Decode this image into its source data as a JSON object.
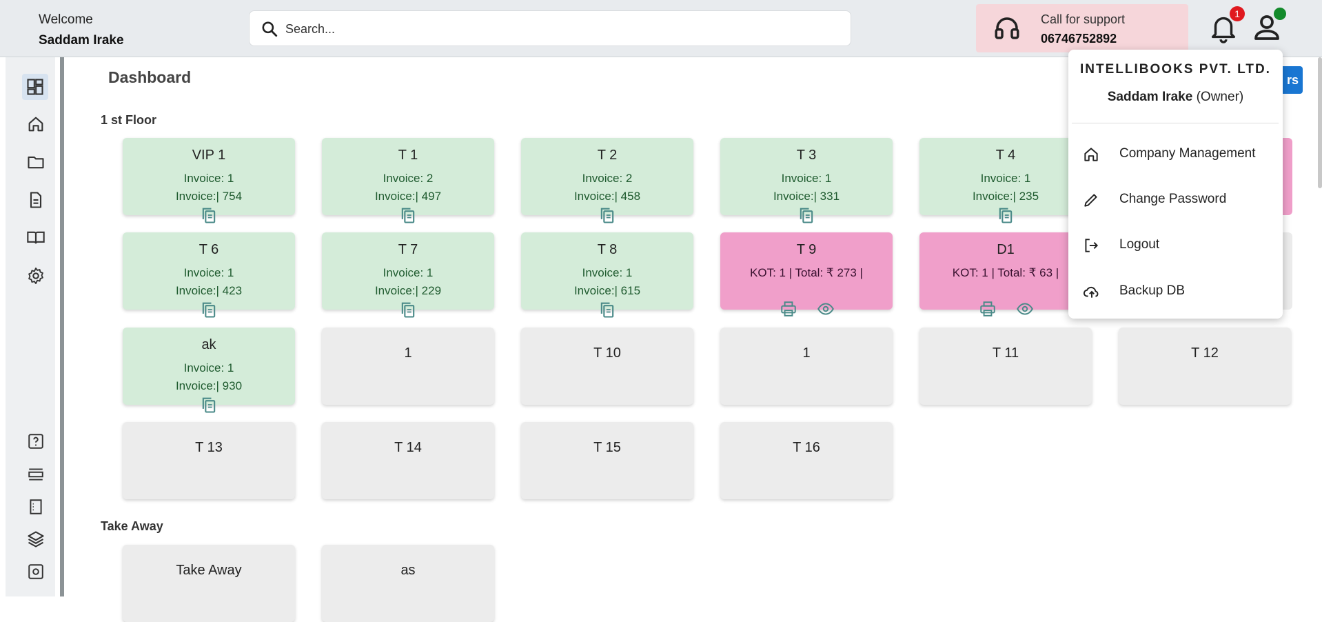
{
  "header": {
    "welcome": "Welcome",
    "user_name": "Saddam Irake",
    "search_placeholder": "Search...",
    "support_label": "Call for support",
    "support_phone": "06746752892",
    "notification_count": "1"
  },
  "main": {
    "title": "Dashboard",
    "orders_button_fragment": "rs",
    "sections": [
      {
        "title": "1 st Floor",
        "tables": [
          {
            "name": "VIP 1",
            "status": "billed",
            "line1": "Invoice: 1",
            "line2": "Invoice:| 754"
          },
          {
            "name": "T 1",
            "status": "billed",
            "line1": "Invoice: 2",
            "line2": "Invoice:| 497"
          },
          {
            "name": "T 2",
            "status": "billed",
            "line1": "Invoice: 2",
            "line2": "Invoice:| 458"
          },
          {
            "name": "T 3",
            "status": "billed",
            "line1": "Invoice: 1",
            "line2": "Invoice:| 331"
          },
          {
            "name": "T 4",
            "status": "billed",
            "line1": "Invoice: 1",
            "line2": "Invoice:| 235"
          },
          {
            "name": "T 6",
            "status": "billed",
            "line1": "Invoice: 1",
            "line2": "Invoice:| 423"
          },
          {
            "name": "T 7",
            "status": "billed",
            "line1": "Invoice: 1",
            "line2": "Invoice:| 229"
          },
          {
            "name": "T 8",
            "status": "billed",
            "line1": "Invoice: 1",
            "line2": "Invoice:| 615"
          },
          {
            "name": "T 9",
            "status": "running",
            "line1": "KOT: 1 | Total: ₹ 273 |"
          },
          {
            "name": "D1",
            "status": "running",
            "line1": "KOT: 1 | Total: ₹ 63 |"
          },
          {
            "name": "ak",
            "status": "billed",
            "line1": "Invoice: 1",
            "line2": "Invoice:| 930"
          },
          {
            "name": "1",
            "status": "free"
          },
          {
            "name": "T 10",
            "status": "free"
          },
          {
            "name": "1",
            "status": "free"
          },
          {
            "name": "T 11",
            "status": "free"
          },
          {
            "name": "T 12",
            "status": "free"
          },
          {
            "name": "T 13",
            "status": "free"
          },
          {
            "name": "T 14",
            "status": "free"
          },
          {
            "name": "T 15",
            "status": "free"
          },
          {
            "name": "T 16",
            "status": "free"
          }
        ]
      },
      {
        "title": "Take Away",
        "tables": [
          {
            "name": "Take Away",
            "status": "free"
          },
          {
            "name": "as",
            "status": "free"
          }
        ]
      }
    ]
  },
  "profile_menu": {
    "company": "INTELLIBOOKS PVT. LTD.",
    "user_name": "Saddam Irake",
    "role": "(Owner)",
    "items": [
      {
        "label": "Company Management",
        "icon": "home-icon"
      },
      {
        "label": "Change Password",
        "icon": "pencil-icon"
      },
      {
        "label": "Logout",
        "icon": "logout-icon"
      },
      {
        "label": "Backup DB",
        "icon": "cloud-upload-icon"
      }
    ]
  },
  "sidebar": {
    "items": [
      {
        "icon": "dashboard-icon"
      },
      {
        "icon": "home-icon"
      },
      {
        "icon": "folder-icon"
      },
      {
        "icon": "document-icon"
      },
      {
        "icon": "book-icon"
      },
      {
        "icon": "settings-icon"
      },
      {
        "icon": "help-icon"
      },
      {
        "icon": "list-icon"
      },
      {
        "icon": "receipt-icon"
      },
      {
        "icon": "layers-icon"
      },
      {
        "icon": "settings-box-icon"
      }
    ]
  },
  "colors": {
    "billed": "#d4ecd9",
    "running": "#f09fca",
    "free": "#ececec",
    "accent": "#1976d2"
  }
}
